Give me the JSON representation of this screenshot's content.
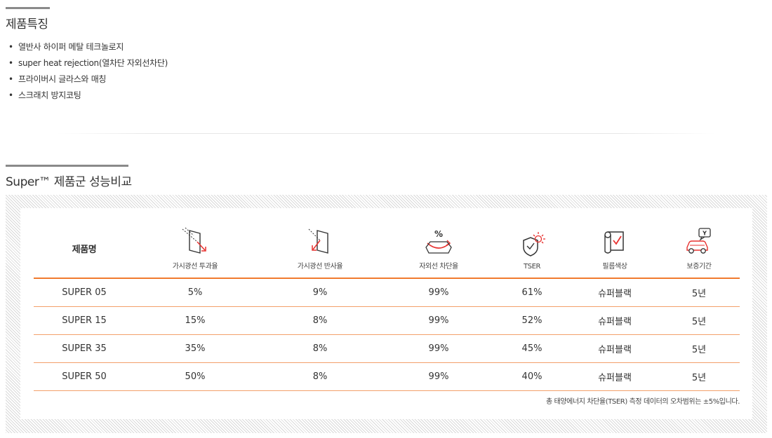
{
  "features": {
    "title": "제품특징",
    "items": [
      "열반사 하이퍼 메탈 테크놀로지",
      "super heat rejection(열차단 자외선차단)",
      "프라이버시 글라스와 매칭",
      "스크래치 방지코팅"
    ]
  },
  "comparison": {
    "title": "Super™ 제품군 성능비교",
    "columns": [
      {
        "label": "제품명",
        "icon": null
      },
      {
        "label": "가시광선 투과율",
        "icon": "visible-light-transmission-icon"
      },
      {
        "label": "가시광선 반사율",
        "icon": "visible-light-reflection-icon"
      },
      {
        "label": "자외선 차단율",
        "icon": "uv-block-icon"
      },
      {
        "label": "TSER",
        "icon": "tser-shield-sun-icon"
      },
      {
        "label": "필름색상",
        "icon": "film-color-icon"
      },
      {
        "label": "보증기간",
        "icon": "warranty-car-icon"
      }
    ],
    "rows": [
      [
        "SUPER 05",
        "5%",
        "9%",
        "99%",
        "61%",
        "슈퍼블랙",
        "5년"
      ],
      [
        "SUPER 15",
        "15%",
        "8%",
        "99%",
        "52%",
        "슈퍼블랙",
        "5년"
      ],
      [
        "SUPER 35",
        "35%",
        "8%",
        "99%",
        "45%",
        "슈퍼블랙",
        "5년"
      ],
      [
        "SUPER 50",
        "50%",
        "8%",
        "99%",
        "40%",
        "슈퍼블랙",
        "5년"
      ]
    ],
    "note": "총 태양에너지 차단율(TSER) 측정 데이터의 오차범위는 ±5%입니다.",
    "colors": {
      "accent": "#f07a2e",
      "row_line": "#f3a06a",
      "icon_stroke": "#333333",
      "icon_red": "#e8312f"
    },
    "percent_glyph": "%",
    "warranty_glyph": "Y"
  }
}
